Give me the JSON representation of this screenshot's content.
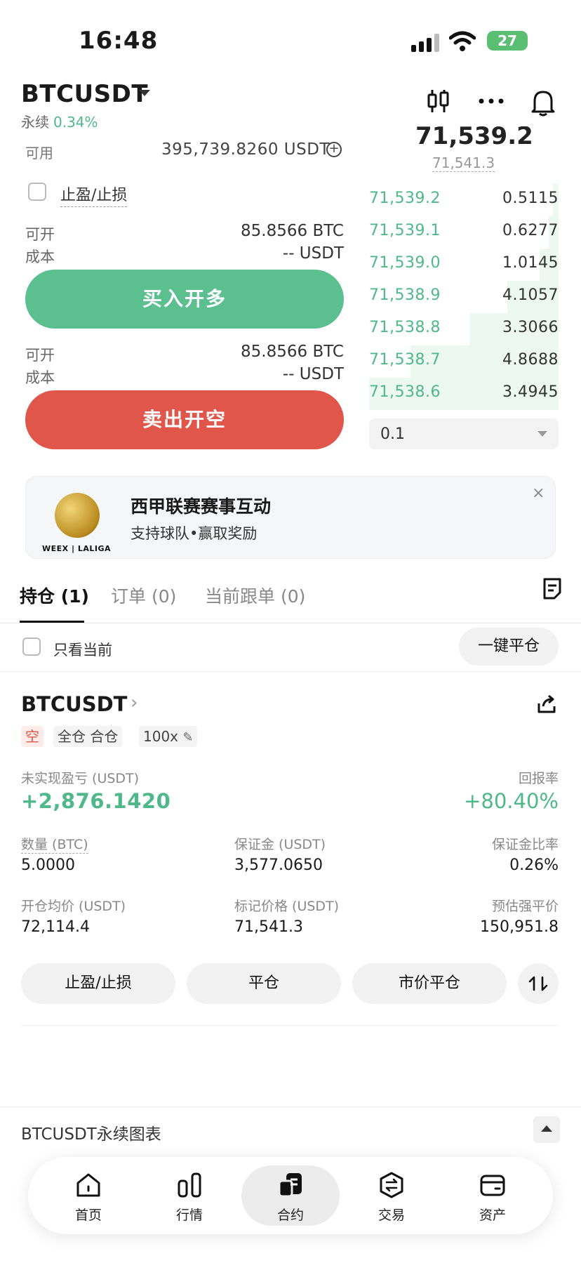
{
  "status": {
    "time": "16:48",
    "battery": "27"
  },
  "header": {
    "symbol": "BTCUSDT",
    "perp_label": "永续",
    "change": "0.34%"
  },
  "trade": {
    "available_label": "可用",
    "available_value": "395,739.8260 USDT",
    "tpsl_label": "止盈/止损",
    "buy_block": {
      "open_label": "可开",
      "open_value": "85.8566 BTC",
      "cost_label": "成本",
      "cost_value": "-- USDT"
    },
    "buy_button": "买入开多",
    "sell_block": {
      "open_label": "可开",
      "open_value": "85.8566 BTC",
      "cost_label": "成本",
      "cost_value": "-- USDT"
    },
    "sell_button": "卖出开空"
  },
  "orderbook": {
    "last_price": "71,539.2",
    "mark_price": "71,541.3",
    "bids": [
      {
        "price": "71,539.2",
        "qty": "0.5115",
        "depth": 0.03
      },
      {
        "price": "71,539.1",
        "qty": "0.6277",
        "depth": 0.05
      },
      {
        "price": "71,539.0",
        "qty": "1.0145",
        "depth": 0.1
      },
      {
        "price": "71,538.9",
        "qty": "4.1057",
        "depth": 0.27
      },
      {
        "price": "71,538.8",
        "qty": "3.3066",
        "depth": 0.47
      },
      {
        "price": "71,538.7",
        "qty": "4.8688",
        "depth": 0.78
      },
      {
        "price": "71,538.6",
        "qty": "3.4945",
        "depth": 1.0
      }
    ],
    "depth_step": "0.1"
  },
  "banner": {
    "title": "西甲联赛赛事互动",
    "subtitle": "支持球队•赢取奖励",
    "brand": "WEEX | LALIGA",
    "close": "×"
  },
  "tabs": [
    {
      "label": "持仓 (1)"
    },
    {
      "label": "订单 (0)"
    },
    {
      "label": "当前跟单 (0)"
    }
  ],
  "filter": {
    "current_only": "只看当前",
    "close_all": "一键平仓"
  },
  "position": {
    "symbol": "BTCUSDT",
    "side": "空",
    "margin_mode": "全仓 合仓",
    "leverage": "100x",
    "pnl_label": "未实现盈亏 (USDT)",
    "pnl_value": "+2,876.1420",
    "roe_label": "回报率",
    "roe_value": "+80.40%",
    "qty_label": "数量 (BTC)",
    "qty_value": "5.0000",
    "margin_label": "保证金 (USDT)",
    "margin_value": "3,577.0650",
    "margin_ratio_label": "保证金比率",
    "margin_ratio_value": "0.26%",
    "entry_label": "开仓均价 (USDT)",
    "entry_value": "72,114.4",
    "mark_label": "标记价格 (USDT)",
    "mark_value": "71,541.3",
    "liq_label": "预估强平价",
    "liq_value": "150,951.8",
    "actions": {
      "tpsl": "止盈/止损",
      "close": "平仓",
      "market_close": "市价平仓"
    }
  },
  "chart_section": {
    "label": "BTCUSDT永续图表"
  },
  "nav": [
    {
      "label": "首页",
      "icon": "home-icon"
    },
    {
      "label": "行情",
      "icon": "market-icon"
    },
    {
      "label": "合约",
      "icon": "contract-icon"
    },
    {
      "label": "交易",
      "icon": "trade-icon"
    },
    {
      "label": "资产",
      "icon": "wallet-icon"
    }
  ],
  "colors": {
    "green": "#4fb88a",
    "buy": "#5bbf90",
    "sell": "#e0564a"
  }
}
